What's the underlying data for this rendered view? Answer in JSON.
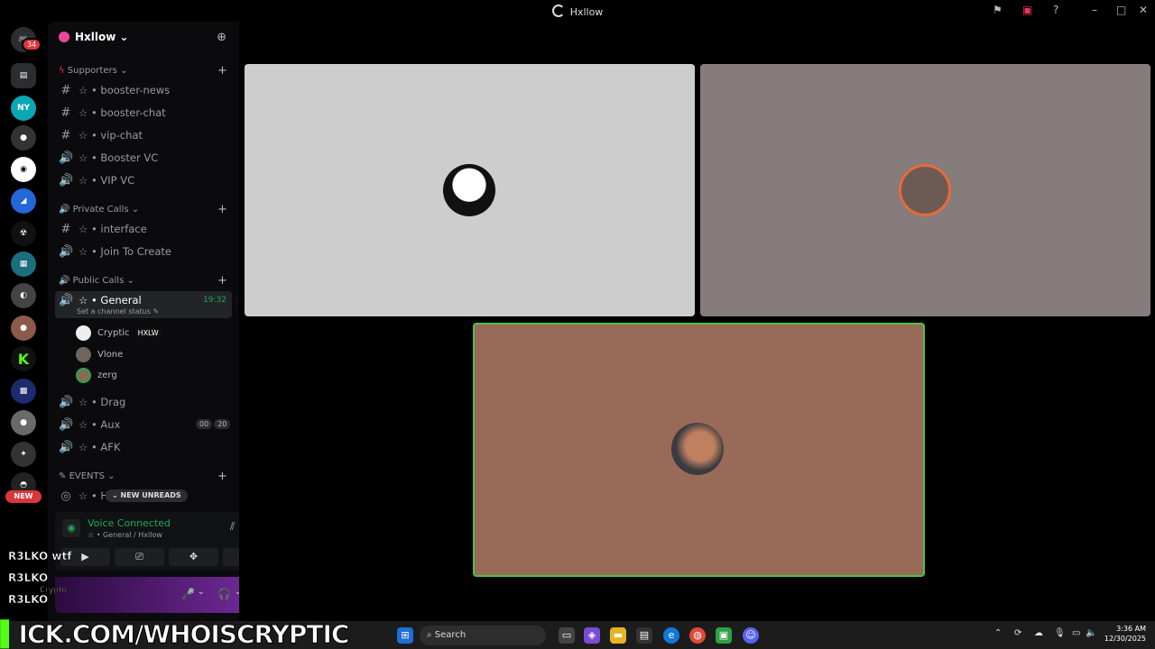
{
  "window": {
    "title": "Hxllow"
  },
  "server_rail": {
    "notification_badge": "34",
    "new_label": "NEW"
  },
  "guild": {
    "name": "Hxllow"
  },
  "categories": [
    {
      "name": "Supporters"
    },
    {
      "name": "Private Calls"
    },
    {
      "name": "Public Calls"
    },
    {
      "name": "EVENTS"
    }
  ],
  "channels": [
    {
      "name": "booster-news",
      "prefix": "☆ •",
      "kind": "text"
    },
    {
      "name": "booster-chat",
      "prefix": "☆ •",
      "kind": "text"
    },
    {
      "name": "vip-chat",
      "prefix": "☆ •",
      "kind": "text"
    },
    {
      "name": "Booster VC",
      "prefix": "☆ •",
      "kind": "voice"
    },
    {
      "name": "VIP VC",
      "prefix": "☆ •",
      "kind": "voice"
    },
    {
      "name": "interface",
      "prefix": "☆ •",
      "kind": "text"
    },
    {
      "name": "Join To Create",
      "prefix": "☆ •",
      "kind": "voice"
    },
    {
      "name": "General",
      "prefix": "☆ •",
      "kind": "voice",
      "timer": "19:32",
      "status": "Set a channel status ✎"
    },
    {
      "name": "Drag",
      "prefix": "☆ •",
      "kind": "voice"
    },
    {
      "name": "Aux",
      "prefix": "☆ •",
      "kind": "voice"
    },
    {
      "name": "AFK",
      "prefix": "☆ •",
      "kind": "voice"
    },
    {
      "name": "H",
      "prefix": "☆ •",
      "kind": "stage"
    }
  ],
  "voice_users": [
    {
      "name": "Cryptic",
      "tag": "HXLW"
    },
    {
      "name": "Vlone"
    },
    {
      "name": "zerg"
    }
  ],
  "aux_counts": [
    "00",
    "20"
  ],
  "new_unreads": "NEW UNREADS",
  "voice_panel": {
    "title": "Voice Connected",
    "subtitle": "☆ • General / Hxllow"
  },
  "overlay": {
    "line1": "R3LKO",
    "line1b": "wtf",
    "line2": "R3LKO",
    "line3": "R3LKO",
    "small": "Cryptic"
  },
  "stream_overlay": {
    "url": "ICK.COM/WHOISCRYPTIC"
  },
  "taskbar": {
    "search_label": "Search",
    "time": "3:36 AM",
    "date": "12/30/2025"
  },
  "colors": {
    "tile1": "#cdcdcd",
    "tile2": "#857c7b",
    "tile3": "#9a6a58",
    "speaking_border": "#4ac24a",
    "online": "#23a55a"
  },
  "icons": [
    "moon-icon",
    "flag-icon",
    "screen-icon",
    "help-icon",
    "hash-icon",
    "speaker-icon",
    "plus-icon",
    "add-user-icon",
    "search-icon",
    "mic-icon",
    "headphones-icon",
    "gear-icon"
  ]
}
